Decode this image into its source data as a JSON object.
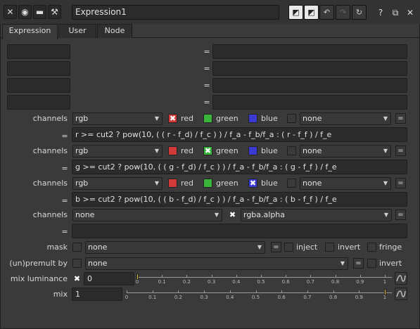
{
  "window": {
    "node_name": "Expression1",
    "buttons": {
      "help": "?"
    }
  },
  "tabs": [
    "Expression",
    "User",
    "Node"
  ],
  "temp_rows": [
    {
      "name": "",
      "eq": "=",
      "expr": ""
    },
    {
      "name": "",
      "eq": "=",
      "expr": ""
    },
    {
      "name": "",
      "eq": "=",
      "expr": ""
    },
    {
      "name": "",
      "eq": "=",
      "expr": ""
    }
  ],
  "channel_groups": [
    {
      "label": "channels",
      "layer": "rgb",
      "checks": [
        {
          "name": "red",
          "checked": true,
          "color": "#d23a3a"
        },
        {
          "name": "green",
          "checked": false,
          "color": "#3ab43a"
        },
        {
          "name": "blue",
          "checked": false,
          "color": "#3a3ad2"
        }
      ],
      "extra": "none",
      "eq": "=",
      "expr": "r >= cut2 ? pow(10, ( ( r - f_d) / f_c ) )  / f_a - f_b/f_a : ( r - f_f ) / f_e"
    },
    {
      "label": "channels",
      "layer": "rgb",
      "checks": [
        {
          "name": "red",
          "checked": false,
          "color": "#d23a3a"
        },
        {
          "name": "green",
          "checked": true,
          "color": "#3ab43a"
        },
        {
          "name": "blue",
          "checked": false,
          "color": "#3a3ad2"
        }
      ],
      "extra": "none",
      "eq": "=",
      "expr": "g >= cut2 ? pow(10, ( ( g - f_d) / f_c ) )  / f_a - f_b/f_a : ( g - f_f ) / f_e"
    },
    {
      "label": "channels",
      "layer": "rgb",
      "checks": [
        {
          "name": "red",
          "checked": false,
          "color": "#d23a3a"
        },
        {
          "name": "green",
          "checked": false,
          "color": "#3ab43a"
        },
        {
          "name": "blue",
          "checked": true,
          "color": "#3a3ad2"
        }
      ],
      "extra": "none",
      "eq": "=",
      "expr": "b >= cut2 ? pow(10, ( ( b - f_d) / f_c ) )  / f_a - f_b/f_a : ( b - f_f ) / f_e"
    }
  ],
  "alpha_group": {
    "label": "channels",
    "layer": "none",
    "alpha_checked": true,
    "alpha_channel": "rgba.alpha",
    "eq": "=",
    "expr": ""
  },
  "mask": {
    "label": "mask",
    "value": "none",
    "eq_btn": "=",
    "inject": "inject",
    "invert": "invert",
    "fringe": "fringe"
  },
  "unpremult": {
    "label": "(un)premult by",
    "value": "none",
    "eq_btn": "=",
    "invert": "invert"
  },
  "mix_luminance": {
    "label": "mix luminance",
    "enabled": false,
    "value": "0"
  },
  "mix": {
    "label": "mix",
    "value": "1"
  },
  "slider_ticks": [
    "0",
    "0.1",
    "0.2",
    "0.3",
    "0.4",
    "0.5",
    "0.6",
    "0.7",
    "0.8",
    "0.9",
    "1"
  ]
}
